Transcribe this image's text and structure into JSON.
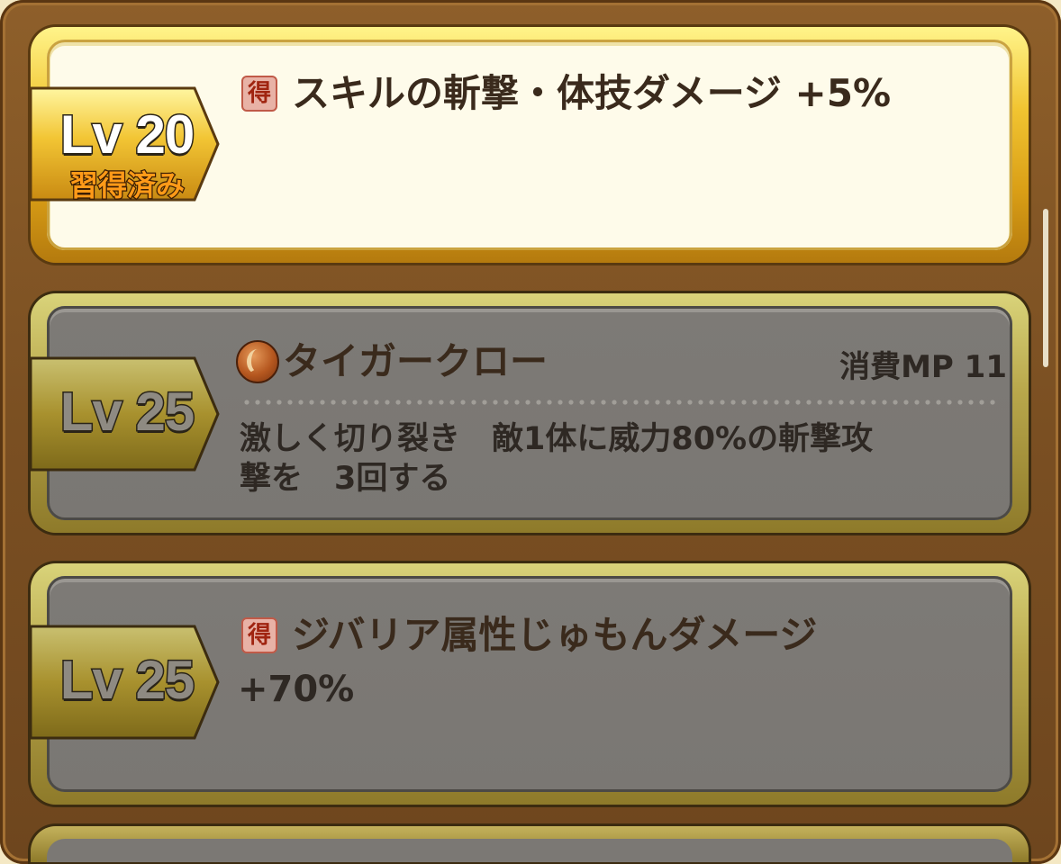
{
  "skills": [
    {
      "level": "Lv 20",
      "status": "習得済み",
      "icon": "toku-icon",
      "icon_label": "得",
      "title": "スキルの斬撃・体技ダメージ +5%",
      "state": "acquired"
    },
    {
      "level": "Lv 25",
      "icon": "claw-orb-icon",
      "title": "タイガークロー",
      "mp": "消費MP 11",
      "description": "激しく切り裂き　敵1体に威力80%の斬撃攻\n撃を　3回する",
      "state": "locked"
    },
    {
      "level": "Lv 25",
      "icon": "toku-icon",
      "icon_label": "得",
      "title": "ジバリア属性じゅもんダメージ",
      "value": "+70%",
      "state": "locked"
    }
  ],
  "colors": {
    "panel_brown": "#7a4f22",
    "gold_frame": "#f1c431",
    "acquired_bg": "#fefbea",
    "locked_bg": "#7a7773",
    "text_dark": "#2e2823",
    "status_orange": "#ff9a18"
  }
}
